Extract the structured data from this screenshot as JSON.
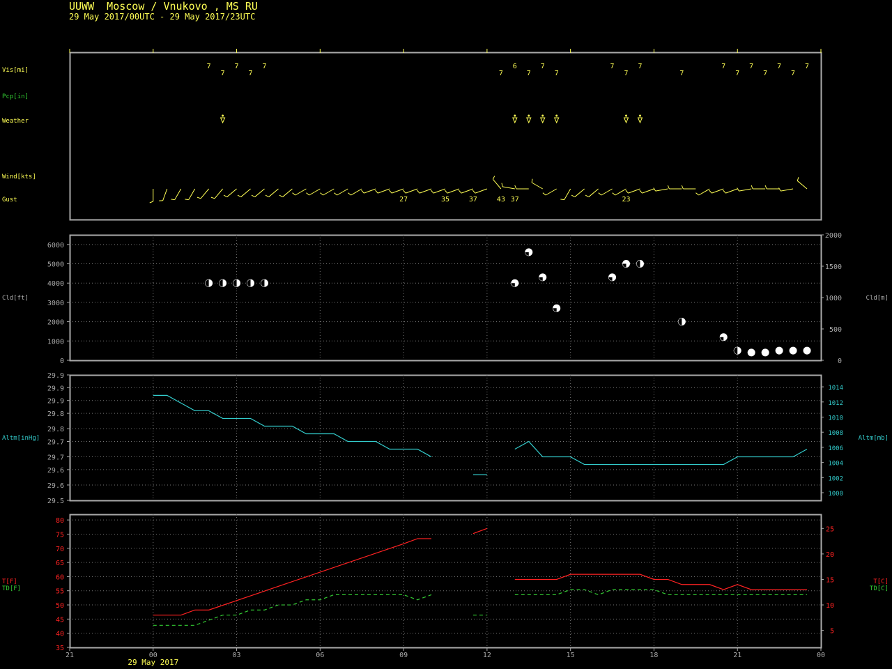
{
  "header": {
    "title": "UUWW  Moscow / Vnukovo , MS RU",
    "period": "29 May 2017/00UTC - 29 May 2017/23UTC"
  },
  "colors": {
    "yellow": "#ffff55",
    "green": "#33cc33",
    "cyan": "#33cccc",
    "red": "#ff2222",
    "frame": "#aaaaaa",
    "grid": "#777777"
  },
  "time_axis": {
    "range_hours": [
      -3,
      24
    ],
    "ticks": [
      {
        "h": -3,
        "label": "21"
      },
      {
        "h": 0,
        "label": "00"
      },
      {
        "h": 3,
        "label": "03"
      },
      {
        "h": 6,
        "label": "06"
      },
      {
        "h": 9,
        "label": "09"
      },
      {
        "h": 12,
        "label": "12"
      },
      {
        "h": 15,
        "label": "15"
      },
      {
        "h": 18,
        "label": "18"
      },
      {
        "h": 21,
        "label": "21"
      },
      {
        "h": 24,
        "label": "00"
      }
    ],
    "date_label": "29 May 2017"
  },
  "chart_data": [
    {
      "type": "scatter",
      "panel": "surface observations",
      "row_labels": {
        "vis": "Vis[mi]",
        "pcp": "Pcp[in]",
        "weather": "Weather",
        "wind": "Wind[kts]",
        "gust": "Gust"
      },
      "visibility": [
        {
          "h": 2.0,
          "v": 7
        },
        {
          "h": 2.5,
          "v": 7
        },
        {
          "h": 3.0,
          "v": 7
        },
        {
          "h": 3.5,
          "v": 7
        },
        {
          "h": 4.0,
          "v": 7
        },
        {
          "h": 12.5,
          "v": 7
        },
        {
          "h": 13.0,
          "v": 6
        },
        {
          "h": 13.5,
          "v": 7
        },
        {
          "h": 14.0,
          "v": 7
        },
        {
          "h": 14.5,
          "v": 7
        },
        {
          "h": 16.5,
          "v": 7
        },
        {
          "h": 17.0,
          "v": 7
        },
        {
          "h": 17.5,
          "v": 7
        },
        {
          "h": 19.0,
          "v": 7
        },
        {
          "h": 20.5,
          "v": 7
        },
        {
          "h": 21.0,
          "v": 7
        },
        {
          "h": 21.5,
          "v": 7
        },
        {
          "h": 22.0,
          "v": 7
        },
        {
          "h": 22.5,
          "v": 7
        },
        {
          "h": 23.0,
          "v": 7
        },
        {
          "h": 23.5,
          "v": 7
        }
      ],
      "weather": [
        {
          "h": 2.5,
          "symbol": "shower"
        },
        {
          "h": 13.0,
          "symbol": "shower"
        },
        {
          "h": 13.5,
          "symbol": "shower"
        },
        {
          "h": 14.0,
          "symbol": "shower"
        },
        {
          "h": 14.5,
          "symbol": "shower"
        },
        {
          "h": 17.0,
          "symbol": "shower"
        },
        {
          "h": 17.5,
          "symbol": "shower"
        }
      ],
      "wind_dir_deg": [
        {
          "h": 0.0,
          "dir": 180
        },
        {
          "h": 0.5,
          "dir": 200
        },
        {
          "h": 1.0,
          "dir": 210
        },
        {
          "h": 1.5,
          "dir": 210
        },
        {
          "h": 2.0,
          "dir": 220
        },
        {
          "h": 2.5,
          "dir": 220
        },
        {
          "h": 3.0,
          "dir": 230
        },
        {
          "h": 3.5,
          "dir": 230
        },
        {
          "h": 4.0,
          "dir": 230
        },
        {
          "h": 4.5,
          "dir": 230
        },
        {
          "h": 5.0,
          "dir": 230
        },
        {
          "h": 5.5,
          "dir": 240
        },
        {
          "h": 6.0,
          "dir": 240
        },
        {
          "h": 6.5,
          "dir": 240
        },
        {
          "h": 7.0,
          "dir": 240
        },
        {
          "h": 7.5,
          "dir": 240
        },
        {
          "h": 8.0,
          "dir": 250
        },
        {
          "h": 8.5,
          "dir": 250
        },
        {
          "h": 9.0,
          "dir": 250
        },
        {
          "h": 9.5,
          "dir": 250
        },
        {
          "h": 10.0,
          "dir": 250
        },
        {
          "h": 10.5,
          "dir": 250
        },
        {
          "h": 11.0,
          "dir": 250
        },
        {
          "h": 11.5,
          "dir": 250
        },
        {
          "h": 12.0,
          "dir": 250
        },
        {
          "h": 12.5,
          "dir": 320
        },
        {
          "h": 13.0,
          "dir": 280
        },
        {
          "h": 13.5,
          "dir": 270
        },
        {
          "h": 14.0,
          "dir": 300
        },
        {
          "h": 14.5,
          "dir": 240
        },
        {
          "h": 15.0,
          "dir": 210
        },
        {
          "h": 15.5,
          "dir": 230
        },
        {
          "h": 16.0,
          "dir": 230
        },
        {
          "h": 16.5,
          "dir": 240
        },
        {
          "h": 17.0,
          "dir": 240
        },
        {
          "h": 17.5,
          "dir": 250
        },
        {
          "h": 18.0,
          "dir": 250
        },
        {
          "h": 18.5,
          "dir": 260
        },
        {
          "h": 19.0,
          "dir": 270
        },
        {
          "h": 19.5,
          "dir": 270
        },
        {
          "h": 20.0,
          "dir": 240
        },
        {
          "h": 20.5,
          "dir": 250
        },
        {
          "h": 21.0,
          "dir": 250
        },
        {
          "h": 21.5,
          "dir": 260
        },
        {
          "h": 22.0,
          "dir": 270
        },
        {
          "h": 22.5,
          "dir": 270
        },
        {
          "h": 23.0,
          "dir": 260
        },
        {
          "h": 23.5,
          "dir": 310
        }
      ],
      "gusts": [
        {
          "h": 9.0,
          "kts": "27"
        },
        {
          "h": 10.5,
          "kts": "35"
        },
        {
          "h": 11.5,
          "kts": "37"
        },
        {
          "h": 12.5,
          "kts": "43"
        },
        {
          "h": 13.0,
          "kts": "37"
        },
        {
          "h": 17.0,
          "kts": "23"
        }
      ]
    },
    {
      "type": "scatter",
      "panel": "cloud base",
      "ylabel": "Cld[ft]",
      "y2label": "Cld[m]",
      "ylim": [
        0,
        6500
      ],
      "yticks": [
        0,
        1000,
        2000,
        3000,
        4000,
        5000,
        6000
      ],
      "y2lim": [
        0,
        2000
      ],
      "y2ticks": [
        0,
        500,
        1000,
        1500,
        2000
      ],
      "points": [
        {
          "h": 2.0,
          "ft": 4000,
          "cover": "broken"
        },
        {
          "h": 2.5,
          "ft": 4000,
          "cover": "broken"
        },
        {
          "h": 3.0,
          "ft": 4000,
          "cover": "broken"
        },
        {
          "h": 3.5,
          "ft": 4000,
          "cover": "broken"
        },
        {
          "h": 4.0,
          "ft": 4000,
          "cover": "broken"
        },
        {
          "h": 13.0,
          "ft": 4000,
          "cover": "scattered"
        },
        {
          "h": 13.5,
          "ft": 5600,
          "cover": "scattered"
        },
        {
          "h": 14.0,
          "ft": 4300,
          "cover": "scattered"
        },
        {
          "h": 14.5,
          "ft": 2700,
          "cover": "scattered"
        },
        {
          "h": 16.5,
          "ft": 4300,
          "cover": "scattered"
        },
        {
          "h": 17.0,
          "ft": 5000,
          "cover": "scattered"
        },
        {
          "h": 17.5,
          "ft": 5000,
          "cover": "broken"
        },
        {
          "h": 19.0,
          "ft": 2000,
          "cover": "broken"
        },
        {
          "h": 20.5,
          "ft": 1200,
          "cover": "scattered"
        },
        {
          "h": 21.0,
          "ft": 500,
          "cover": "broken"
        },
        {
          "h": 21.5,
          "ft": 400,
          "cover": "overcast"
        },
        {
          "h": 22.0,
          "ft": 400,
          "cover": "overcast"
        },
        {
          "h": 22.5,
          "ft": 500,
          "cover": "overcast"
        },
        {
          "h": 23.0,
          "ft": 500,
          "cover": "overcast"
        },
        {
          "h": 23.5,
          "ft": 500,
          "cover": "overcast"
        }
      ]
    },
    {
      "type": "line",
      "panel": "altimeter",
      "ylabel": "Altm[inHg]",
      "y2label": "Altm[mb]",
      "ylim": [
        29.5,
        29.99
      ],
      "ytick_values": [
        29.5,
        29.56,
        29.62,
        29.67,
        29.73,
        29.78,
        29.84,
        29.89,
        29.94,
        29.99
      ],
      "ytick_labels": [
        "29.5",
        "29.6",
        "29.6",
        "29.7",
        "29.7",
        "29.8",
        "29.8",
        "29.9",
        "29.9",
        "29.9"
      ],
      "y2ticks": [
        1000,
        1002,
        1004,
        1006,
        1008,
        1010,
        1012,
        1014
      ],
      "series": [
        {
          "name": "",
          "color": "#33cccc",
          "segments": [
            [
              [
                0,
                29.91
              ],
              [
                0.5,
                29.91
              ],
              [
                1.0,
                29.88
              ],
              [
                1.5,
                29.85
              ],
              [
                2.0,
                29.85
              ],
              [
                2.5,
                29.82
              ],
              [
                3.5,
                29.82
              ],
              [
                4.0,
                29.79
              ],
              [
                5.0,
                29.79
              ],
              [
                5.5,
                29.76
              ],
              [
                6.5,
                29.76
              ],
              [
                7.0,
                29.73
              ],
              [
                8.0,
                29.73
              ],
              [
                8.5,
                29.7
              ],
              [
                9.5,
                29.7
              ],
              [
                10.0,
                29.67
              ]
            ],
            [
              [
                11.5,
                29.6
              ],
              [
                12.0,
                29.6
              ]
            ],
            [
              [
                13.0,
                29.7
              ],
              [
                13.5,
                29.73
              ],
              [
                14.0,
                29.67
              ],
              [
                15.0,
                29.67
              ],
              [
                15.5,
                29.64
              ],
              [
                20.5,
                29.64
              ],
              [
                21.0,
                29.67
              ],
              [
                23.0,
                29.67
              ],
              [
                23.5,
                29.7
              ]
            ]
          ]
        }
      ]
    },
    {
      "type": "line",
      "panel": "temperature / dewpoint",
      "ylabel": "T[F]",
      "ylabel2": "TD[F]",
      "y2label": "T[C]",
      "y2label2": "TD[C]",
      "ylim": [
        35,
        82
      ],
      "yticks": [
        35,
        40,
        45,
        50,
        55,
        60,
        65,
        70,
        75,
        80
      ],
      "y2ticks": [
        5,
        10,
        15,
        20,
        25
      ],
      "series": [
        {
          "name": "T[F]",
          "color": "#ff2222",
          "dash": "none",
          "segments": [
            [
              [
                0,
                46.4
              ],
              [
                1.0,
                46.4
              ],
              [
                1.5,
                48.2
              ],
              [
                2.0,
                48.2
              ],
              [
                9.0,
                71.6
              ],
              [
                9.5,
                73.4
              ],
              [
                10.0,
                73.4
              ]
            ],
            [
              [
                11.5,
                75.2
              ],
              [
                12.0,
                77.0
              ]
            ],
            [
              [
                13.0,
                59.0
              ],
              [
                14.5,
                59.0
              ],
              [
                15.0,
                60.8
              ],
              [
                17.5,
                60.8
              ],
              [
                18.0,
                59.0
              ],
              [
                18.5,
                59.0
              ],
              [
                19.0,
                57.2
              ],
              [
                20.0,
                57.2
              ],
              [
                20.5,
                55.4
              ],
              [
                21.0,
                57.2
              ],
              [
                21.5,
                55.4
              ],
              [
                23.5,
                55.4
              ]
            ]
          ]
        },
        {
          "name": "TD[F]",
          "color": "#33cc33",
          "dash": "5,4",
          "segments": [
            [
              [
                0,
                42.8
              ],
              [
                1.5,
                42.8
              ],
              [
                2.0,
                44.6
              ],
              [
                2.5,
                46.4
              ],
              [
                3.0,
                46.4
              ],
              [
                3.5,
                48.2
              ],
              [
                4.0,
                48.2
              ],
              [
                4.5,
                50.0
              ],
              [
                5.0,
                50.0
              ],
              [
                5.5,
                51.8
              ],
              [
                6.0,
                51.8
              ],
              [
                6.5,
                53.6
              ],
              [
                9.0,
                53.6
              ],
              [
                9.5,
                51.8
              ],
              [
                10.0,
                53.6
              ]
            ],
            [
              [
                11.5,
                46.4
              ],
              [
                12.0,
                46.4
              ]
            ],
            [
              [
                13.0,
                53.6
              ],
              [
                14.5,
                53.6
              ],
              [
                15.0,
                55.4
              ],
              [
                15.5,
                55.4
              ],
              [
                16.0,
                53.6
              ],
              [
                16.5,
                55.4
              ],
              [
                18.0,
                55.4
              ],
              [
                18.5,
                53.6
              ],
              [
                23.5,
                53.6
              ]
            ]
          ]
        }
      ]
    }
  ]
}
